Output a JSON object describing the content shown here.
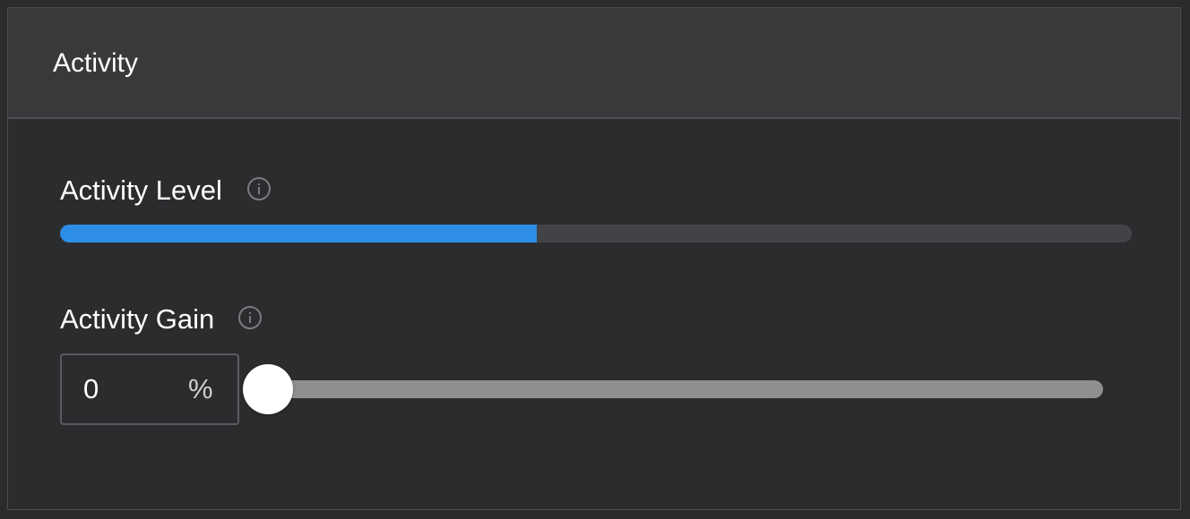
{
  "panel": {
    "title": "Activity"
  },
  "activity_level": {
    "label": "Activity Level",
    "info_icon": "info-icon",
    "level_fraction": 0.445,
    "fill_color": "#2e8de6"
  },
  "activity_gain": {
    "label": "Activity Gain",
    "info_icon": "info-icon",
    "value": "0",
    "unit": "%",
    "slider_fraction": 0
  }
}
